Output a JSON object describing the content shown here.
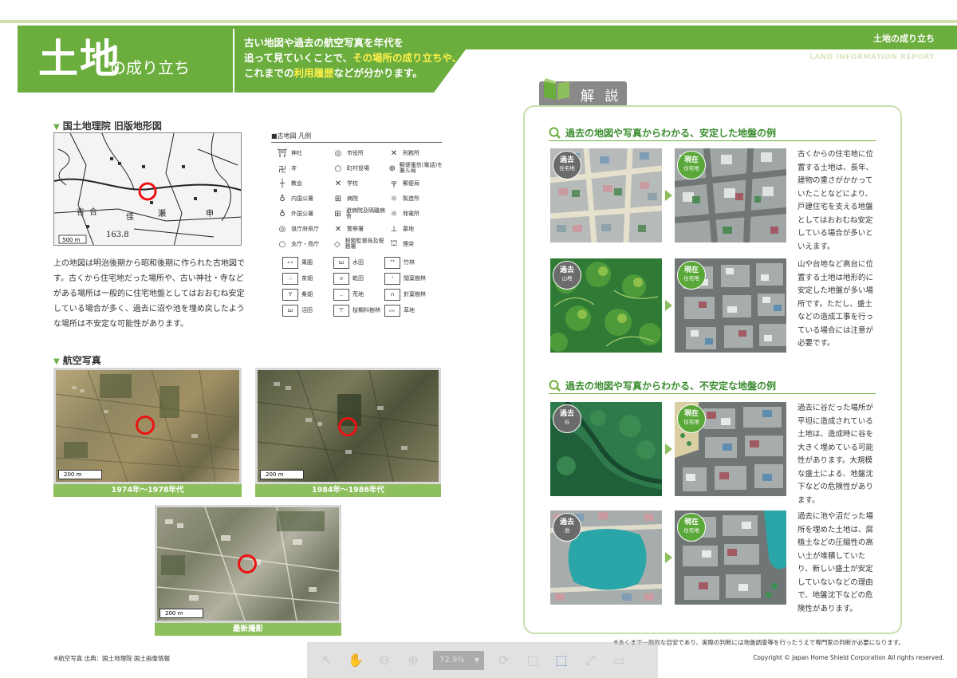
{
  "header": {
    "title_main": "土地",
    "title_sub": "の成り立ち",
    "intro_line1": "古い地図や過去の航空写真を年代を",
    "intro_line2_pre": "追って見ていくことで、",
    "intro_line2_hl": "その場所の成り立ちや、",
    "intro_line3_pre": "これまでの",
    "intro_line3_hl": "利用履歴",
    "intro_line3_post": "などが分かります。",
    "report_tag": "土地の成り立ち",
    "report_en": "LAND INFORMATION REPORT"
  },
  "old_map": {
    "heading": "国土地理院 旧版地形図",
    "scale_label": "500 m",
    "caption": "上の地図は明治後期から昭和後期に作られた古地図です。古くから住宅地だった場所や、古い神社・寺などがある場所は一般的に住宅地盤としてはおおむね安定している場合が多く、過去に沼や池を埋め戻したような場所は不安定な可能性があります。"
  },
  "legend": {
    "title": "■古地図 凡例",
    "symbols": [
      {
        "sym": "⛩",
        "label": "神社"
      },
      {
        "sym": "◎",
        "label": "市役所"
      },
      {
        "sym": "✕",
        "label": "刑務所"
      },
      {
        "sym": "卍",
        "label": "寺"
      },
      {
        "sym": "○",
        "label": "町村役場"
      },
      {
        "sym": "⊕",
        "label": "郵便電信(電話)を兼ル局"
      },
      {
        "sym": "┼",
        "label": "教会"
      },
      {
        "sym": "✕",
        "label": "学校"
      },
      {
        "sym": "〒",
        "label": "郵便局"
      },
      {
        "sym": "♁",
        "label": "内国公署"
      },
      {
        "sym": "⊞",
        "label": "病院"
      },
      {
        "sym": "☼",
        "label": "製造所"
      },
      {
        "sym": "♁",
        "label": "外国公署"
      },
      {
        "sym": "⊞",
        "label": "避病院及隔離病舎"
      },
      {
        "sym": "☼",
        "label": "発電所"
      },
      {
        "sym": "◎",
        "label": "道庁府県庁"
      },
      {
        "sym": "✕",
        "label": "警察署"
      },
      {
        "sym": "⊥",
        "label": "墓地"
      },
      {
        "sym": "○",
        "label": "支庁・島庁"
      },
      {
        "sym": "◇",
        "label": "税務監督局及税務署"
      },
      {
        "sym": "⛫",
        "label": "煙突"
      }
    ],
    "land_types": [
      {
        "sym": "∘∘",
        "label": "果園"
      },
      {
        "sym": "ш",
        "label": "水田"
      },
      {
        "sym": "ᵀᵀ",
        "label": "竹林"
      },
      {
        "sym": "∴",
        "label": "茶畑"
      },
      {
        "sym": "ıı",
        "label": "乾田"
      },
      {
        "sym": "ᑊ",
        "label": "闊葉樹林"
      },
      {
        "sym": "Y",
        "label": "桑畑"
      },
      {
        "sym": "‥",
        "label": "荒地"
      },
      {
        "sym": "∩",
        "label": "針葉樹林"
      },
      {
        "sym": "ш",
        "label": "沼田"
      },
      {
        "sym": "ㄒ",
        "label": "桜櫚科樹林"
      },
      {
        "sym": "ᨐ",
        "label": "草地"
      }
    ]
  },
  "aerial": {
    "heading": "航空写真",
    "photos": [
      {
        "caption": "1974年〜1978年代",
        "scale": "200 m"
      },
      {
        "caption": "1984年〜1986年代",
        "scale": "200 m"
      },
      {
        "caption": "最新撮影",
        "scale": "200 m"
      }
    ]
  },
  "panel": {
    "tab_label": "解 説",
    "stable_heading": "過去の地図や写真からわかる、安定した地盤の例",
    "unstable_heading": "過去の地図や写真からわかる、不安定な地盤の例",
    "cases": [
      {
        "past_label": "過去",
        "past_sub": "住宅地",
        "now_label": "現在",
        "now_sub": "住宅地",
        "text": "古くからの住宅地に位置する土地は、長年、建物の重さがかかっていたことなどにより、戸建住宅を支える地盤としてはおおむね安定している場合が多いといえます。"
      },
      {
        "past_label": "過去",
        "past_sub": "山地",
        "now_label": "現在",
        "now_sub": "住宅地",
        "text": "山や台地など高台に位置する土地は地形的に安定した地盤が多い場所です。ただし、盛土などの造成工事を行っている場合には注意が必要です。"
      },
      {
        "past_label": "過去",
        "past_sub": "谷",
        "now_label": "現在",
        "now_sub": "住宅地",
        "text": "過去に谷だった場所が平坦に造成されている土地は、造成時に谷を大きく埋めている可能性があります。大規模な盛土による、地盤沈下などの危険性があります。"
      },
      {
        "past_label": "過去",
        "past_sub": "池",
        "now_label": "現在",
        "now_sub": "住宅地",
        "text": "過去に池や沼だった場所を埋めた土地は、腐植土などの圧縮性の高い土が堆積していたり、新しい盛土が安定していないなどの理由で、地盤沈下などの危険性があります。"
      }
    ]
  },
  "footer": {
    "disclaimer": "※あくまで一般的な目安であり、実際の判断には地盤調査等を行ったうえで専門家の判断が必要になります。",
    "source": "※航空写真 出典：国土地理院 国土画像情報",
    "copyright": "Copyright © Japan Home Shield Corporation All rights reserved."
  },
  "viewer_toolbar": {
    "zoom": "72.9%",
    "icons": [
      "select-icon",
      "hand-icon",
      "zoom-out-icon",
      "zoom-in-icon",
      "zoom-dropdown",
      "rotate-icon",
      "fit-page-icon",
      "fit-width-icon",
      "fullscreen-icon",
      "comment-icon"
    ]
  },
  "colors": {
    "brand_green": "#6cae3e",
    "light_green": "#8dbf5c",
    "highlight_yellow": "#fff04a",
    "marker_red": "#e11111"
  }
}
